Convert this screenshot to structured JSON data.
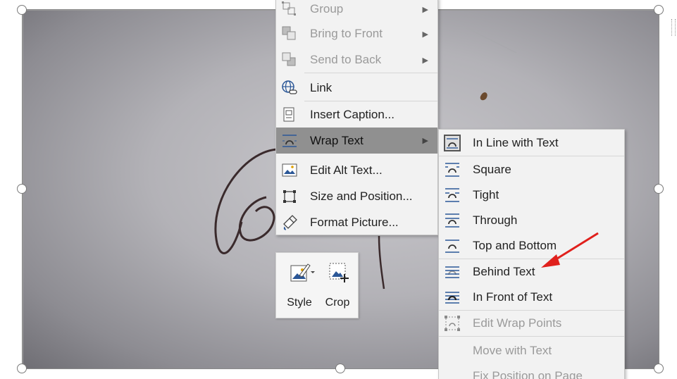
{
  "context_menu": {
    "items": [
      {
        "label": "Group",
        "disabled": true,
        "submenu": true
      },
      {
        "label": "Bring to Front",
        "disabled": true,
        "submenu": true
      },
      {
        "label": "Send to Back",
        "disabled": true,
        "submenu": true
      },
      {
        "label": "Link",
        "disabled": false,
        "submenu": true
      },
      {
        "label": "Insert Caption...",
        "disabled": false,
        "submenu": false
      },
      {
        "label": "Wrap Text",
        "disabled": false,
        "submenu": true,
        "hover": true
      },
      {
        "label": "Edit Alt Text...",
        "disabled": false,
        "submenu": false
      },
      {
        "label": "Size and Position...",
        "disabled": false,
        "submenu": false
      },
      {
        "label": "Format Picture...",
        "disabled": false,
        "submenu": false
      }
    ]
  },
  "wrap_submenu": {
    "items": [
      {
        "label": "In Line with Text",
        "selected": true
      },
      {
        "label": "Square"
      },
      {
        "label": "Tight"
      },
      {
        "label": "Through"
      },
      {
        "label": "Top and Bottom"
      },
      {
        "label": "Behind Text"
      },
      {
        "label": "In Front of Text"
      },
      {
        "label": "Edit Wrap Points",
        "disabled": true
      },
      {
        "label": "Move with Text",
        "disabled": true
      },
      {
        "label": "Fix Position on Page",
        "disabled": true
      }
    ]
  },
  "mini_toolbar": {
    "style_label": "Style",
    "crop_label": "Crop"
  },
  "colors": {
    "menu_bg": "#f2f2f2",
    "hover_bg": "#909090",
    "annotation_arrow": "#e0201c",
    "icon_blue": "#2b5797"
  }
}
